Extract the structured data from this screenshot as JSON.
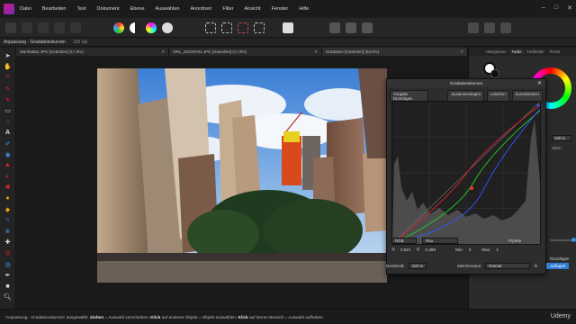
{
  "menubar": {
    "items": [
      "Datei",
      "Bearbeiten",
      "Text",
      "Dokument",
      "Ebene",
      "Auswählen",
      "Anordnen",
      "Filter",
      "Ansicht",
      "Fenster",
      "Hilfe"
    ]
  },
  "context": {
    "title": "Anpassung - Gradationskurven",
    "dpi": "150 dpi"
  },
  "tabs": [
    {
      "label": "Manhattan.JPG [Geändert] (17,9%)"
    },
    {
      "label": "ORL_15C08761.JPG [Geändert] (17,9%)"
    },
    {
      "label": "Gradation [Geändert] (53,0%)"
    }
  ],
  "right_panel": {
    "tabs": [
      "Histogramm",
      "Farbe",
      "Farbfelder",
      "Pinsel"
    ],
    "zoom": "100 %",
    "stroke_label": "Strich",
    "add_label": "hinzufügen"
  },
  "dialog": {
    "title": "Gradationskurven",
    "buttons": {
      "preset": "Vorgabe hinzufügen",
      "merge": "Zusammenlegen",
      "delete": "Löschen",
      "reset": "Zurücksetzen"
    },
    "channel": "RGB",
    "channel2": "Rau",
    "pipette": "Pipette",
    "coords": {
      "x": "0,521",
      "y": "0,389"
    },
    "min_label": "Min:",
    "min_val": "0",
    "max_label": "Max:",
    "max_val": "1",
    "opacity_label": "Deckkraft:",
    "opacity_val": "100 %",
    "blend_label": "Mischmodus:",
    "blend_val": "Normal",
    "add_button": "hinzufügen",
    "apply_button": "Anfügen"
  },
  "status": {
    "prefix": "'Anpassung - Gradationskurven' ausgewählt.",
    "b1": "Ziehen",
    "t1": "= Auswahl verschieben.",
    "b2": "Klick",
    "t2": "auf anderes Objekt = Objekt auswählen.",
    "b3": "Klick",
    "t3": "auf leeren Bereich = Auswahl aufheben."
  },
  "watermark": "Udemy",
  "colors": {
    "brand": "#c9197b",
    "accent": "#2f7ed8"
  }
}
